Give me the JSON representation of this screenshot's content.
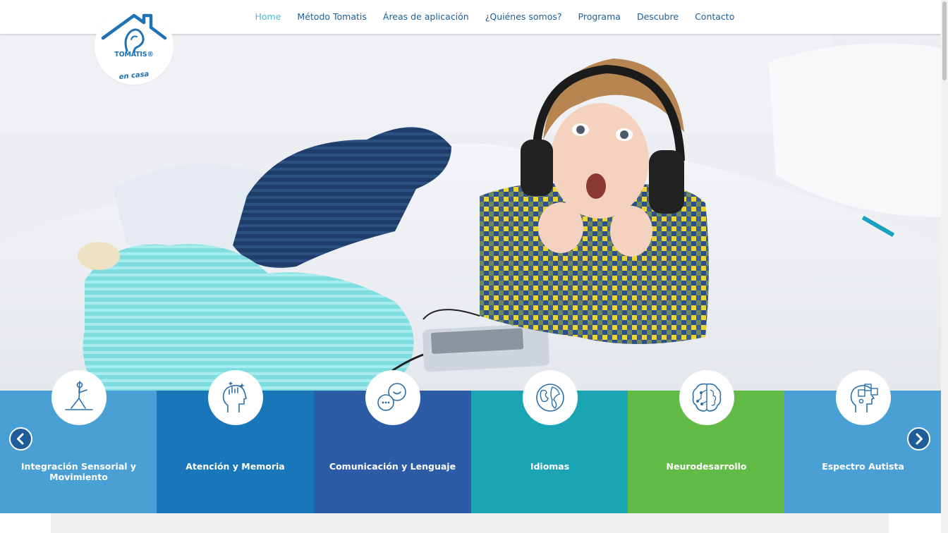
{
  "nav": {
    "items": [
      {
        "label": "Home",
        "active": true
      },
      {
        "label": "Método Tomatis",
        "active": false
      },
      {
        "label": "Áreas de aplicación",
        "active": false
      },
      {
        "label": "¿Quiénes somos?",
        "active": false
      },
      {
        "label": "Programa",
        "active": false
      },
      {
        "label": "Descubre",
        "active": false
      },
      {
        "label": "Contacto",
        "active": false
      }
    ]
  },
  "logo": {
    "brand": "TOMATIS®",
    "sub": "en casa",
    "icon": "house-ear-icon"
  },
  "hero": {
    "image": "child-with-headphones-photo"
  },
  "colors": {
    "nav_text": "#1d5f99",
    "nav_active": "#56b5d6",
    "logo": "#1f72b4",
    "arrow": "#1e5c9a"
  },
  "carousel": {
    "cards": [
      {
        "label": "Integración Sensorial y Movimiento",
        "icon": "yoga-pose-icon",
        "color": "#4aa0d5"
      },
      {
        "label": "Atención y Memoria",
        "icon": "head-sparkles-icon",
        "color": "#1976b8"
      },
      {
        "label": "Comunicación y Lenguaje",
        "icon": "chat-bubbles-icon",
        "color": "#2c5ca6"
      },
      {
        "label": "Idiomas",
        "icon": "globe-icon",
        "color": "#1ba4b4"
      },
      {
        "label": "Neurodesarrollo",
        "icon": "brain-circuit-icon",
        "color": "#63bb47"
      },
      {
        "label": "Espectro Autista",
        "icon": "head-puzzle-icon",
        "color": "#4aa0d5"
      }
    ],
    "prev_icon": "chevron-left-icon",
    "next_icon": "chevron-right-icon"
  }
}
